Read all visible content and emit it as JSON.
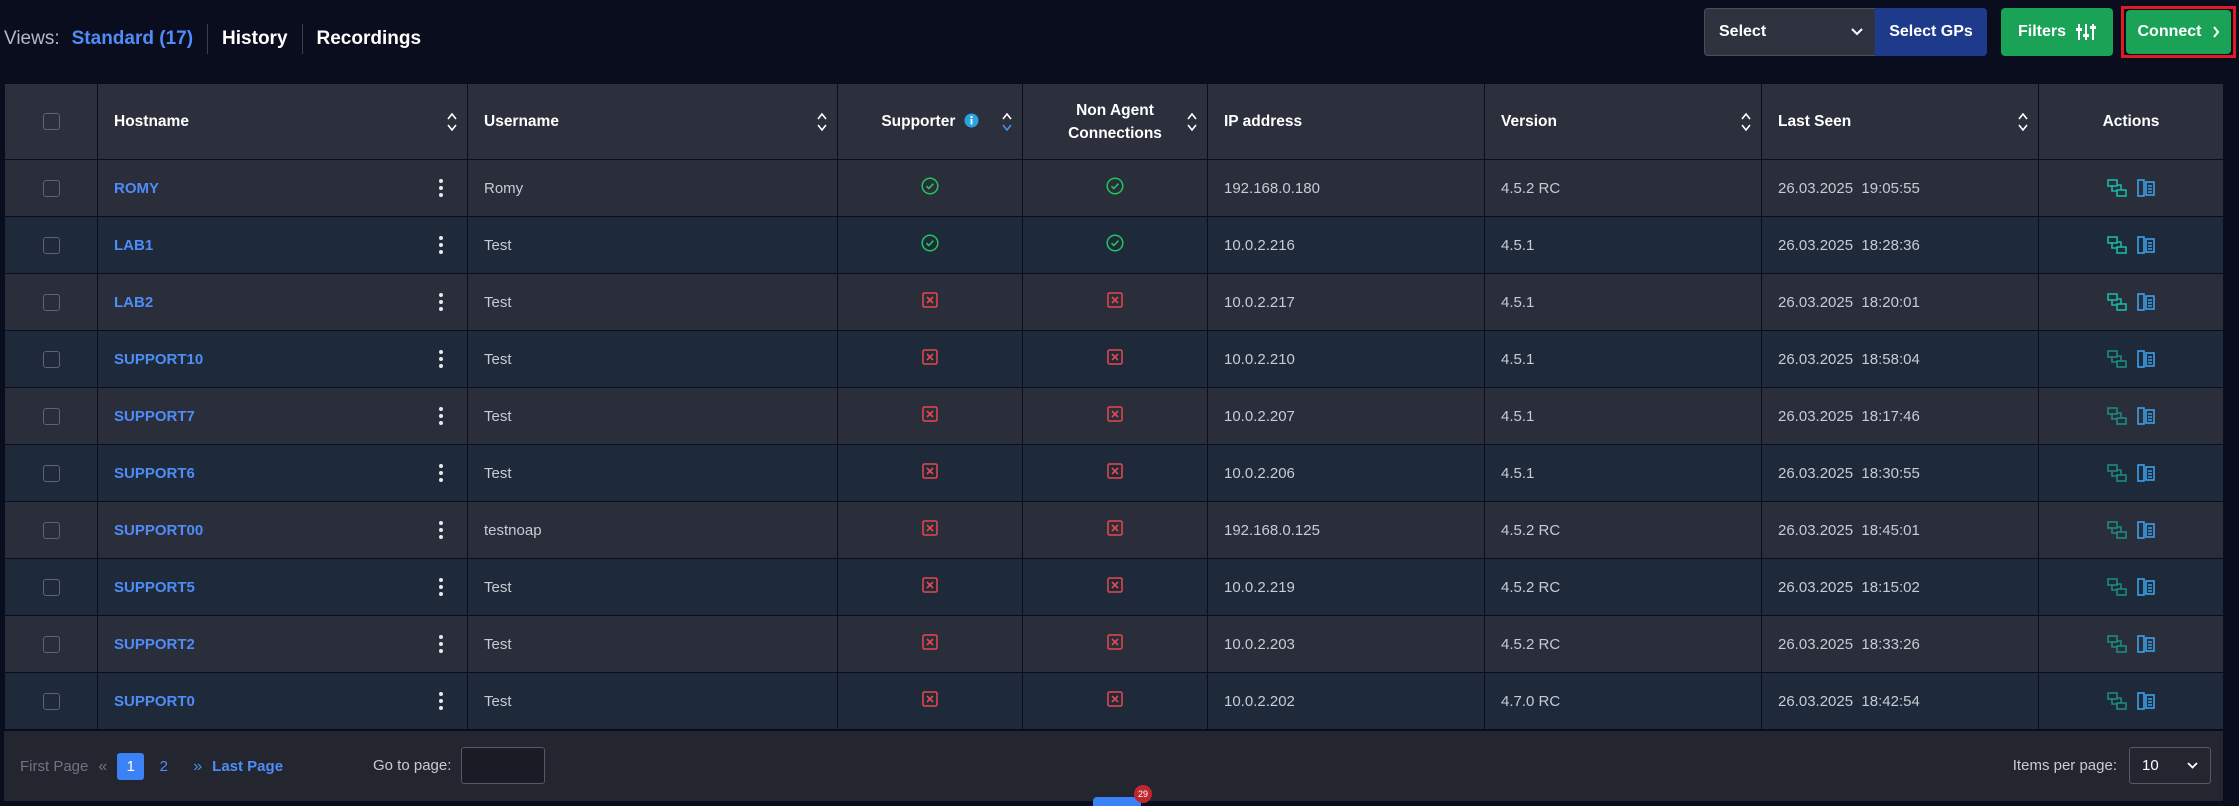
{
  "views": {
    "label": "Views:",
    "items": [
      "Standard (17)",
      "History",
      "Recordings"
    ]
  },
  "toolbar": {
    "select_value": "Select",
    "select_gps": "Select GPs",
    "filters": "Filters",
    "connect": "Connect"
  },
  "table": {
    "headers": {
      "hostname": "Hostname",
      "username": "Username",
      "supporter": "Supporter",
      "non_agent": "Non Agent Connections",
      "ip": "IP address",
      "version": "Version",
      "last_seen": "Last Seen",
      "actions": "Actions"
    },
    "rows": [
      {
        "hostname": "ROMY",
        "username": "Romy",
        "supporter": true,
        "non_agent": true,
        "ip": "192.168.0.180",
        "version": "4.5.2 RC",
        "last_seen": "26.03.2025  19:05:55",
        "action_active": true
      },
      {
        "hostname": "LAB1",
        "username": "Test",
        "supporter": true,
        "non_agent": true,
        "ip": "10.0.2.216",
        "version": "4.5.1",
        "last_seen": "26.03.2025  18:28:36",
        "action_active": true
      },
      {
        "hostname": "LAB2",
        "username": "Test",
        "supporter": false,
        "non_agent": false,
        "ip": "10.0.2.217",
        "version": "4.5.1",
        "last_seen": "26.03.2025  18:20:01",
        "action_active": true
      },
      {
        "hostname": "SUPPORT10",
        "username": "Test",
        "supporter": false,
        "non_agent": false,
        "ip": "10.0.2.210",
        "version": "4.5.1",
        "last_seen": "26.03.2025  18:58:04",
        "action_active": false
      },
      {
        "hostname": "SUPPORT7",
        "username": "Test",
        "supporter": false,
        "non_agent": false,
        "ip": "10.0.2.207",
        "version": "4.5.1",
        "last_seen": "26.03.2025  18:17:46",
        "action_active": false
      },
      {
        "hostname": "SUPPORT6",
        "username": "Test",
        "supporter": false,
        "non_agent": false,
        "ip": "10.0.2.206",
        "version": "4.5.1",
        "last_seen": "26.03.2025  18:30:55",
        "action_active": false
      },
      {
        "hostname": "SUPPORT00",
        "username": "testnoap",
        "supporter": false,
        "non_agent": false,
        "ip": "192.168.0.125",
        "version": "4.5.2 RC",
        "last_seen": "26.03.2025  18:45:01",
        "action_active": false
      },
      {
        "hostname": "SUPPORT5",
        "username": "Test",
        "supporter": false,
        "non_agent": false,
        "ip": "10.0.2.219",
        "version": "4.5.2 RC",
        "last_seen": "26.03.2025  18:15:02",
        "action_active": false
      },
      {
        "hostname": "SUPPORT2",
        "username": "Test",
        "supporter": false,
        "non_agent": false,
        "ip": "10.0.2.203",
        "version": "4.5.2 RC",
        "last_seen": "26.03.2025  18:33:26",
        "action_active": false
      },
      {
        "hostname": "SUPPORT0",
        "username": "Test",
        "supporter": false,
        "non_agent": false,
        "ip": "10.0.2.202",
        "version": "4.7.0 RC",
        "last_seen": "26.03.2025  18:42:54",
        "action_active": false
      }
    ]
  },
  "pagination": {
    "first": "First Page",
    "pages": [
      "1",
      "2"
    ],
    "current": "1",
    "last": "Last Page",
    "goto_label": "Go to page:",
    "goto_value": "",
    "items_per_page_label": "Items per page:",
    "items_per_page": "10"
  },
  "notification_count": "29",
  "colors": {
    "accent": "#4f8cf7",
    "green": "#1aa356",
    "ok": "#22c55e",
    "error": "#e5484d",
    "action_active": "#19b7a5",
    "action_blue": "#3aa0e8"
  }
}
